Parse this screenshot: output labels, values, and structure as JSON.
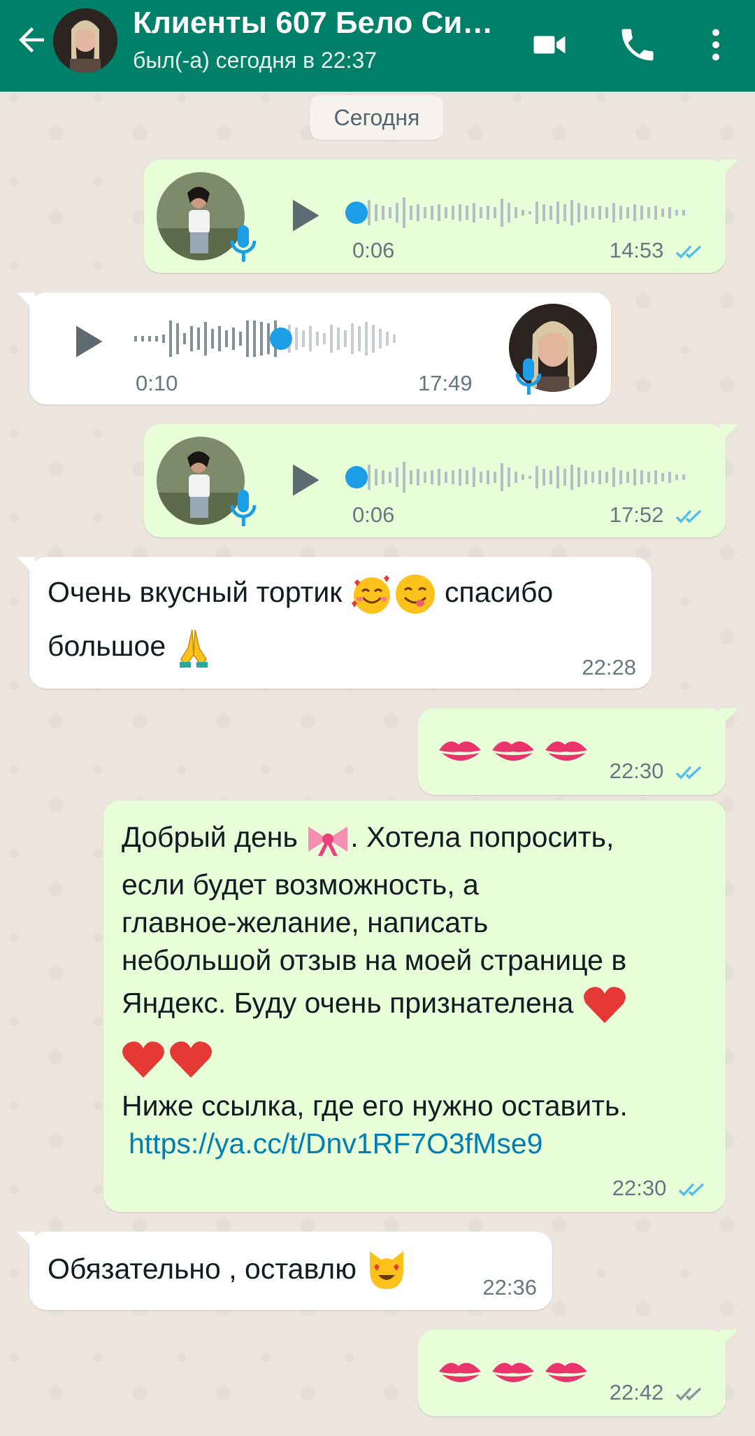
{
  "header": {
    "title": "Клиенты 607 Бело Си…",
    "status": "был(-а) сегодня в 22:37",
    "icons": [
      "back-arrow-icon",
      "video-call-icon",
      "phone-icon",
      "more-vert-icon"
    ]
  },
  "date_chip": "Сегодня",
  "messages": [
    {
      "type": "voice",
      "direction": "out",
      "duration": "0:06",
      "time": "14:53",
      "status": "read"
    },
    {
      "type": "voice",
      "direction": "in",
      "duration": "0:10",
      "time": "17:49"
    },
    {
      "type": "voice",
      "direction": "out",
      "duration": "0:06",
      "time": "17:52",
      "status": "read"
    },
    {
      "type": "text",
      "direction": "in",
      "line1": "Очень вкусный тортик",
      "line1b": "спасибо",
      "line2": "большое",
      "time": "22:28"
    },
    {
      "type": "emoji",
      "direction": "out",
      "time": "22:30",
      "status": "read"
    },
    {
      "type": "text",
      "direction": "out",
      "l1a": "Добрый день",
      "l1b": ".  Хотела попросить,",
      "l2": "если будет возможность,  а",
      "l3": "главное-желание,  написать",
      "l4": "небольшой отзыв на моей странице в",
      "l5": "Яндекс.  Буду очень признателена",
      "l7": "Ниже ссылка, где его нужно оставить.",
      "link": "https://ya.cc/t/Dnv1RF7O3fMse9",
      "time": "22:30",
      "status": "read"
    },
    {
      "type": "text",
      "direction": "in",
      "text": "Обязательно , оставлю",
      "time": "22:36"
    },
    {
      "type": "emoji",
      "direction": "out",
      "time": "22:42",
      "status": "delivered"
    }
  ],
  "colors": {
    "header": "#008069",
    "out_bubble": "#e7fed8",
    "in_bubble": "#ffffff",
    "read_ticks": "#53bdeb",
    "accent_dot": "#1c9ee6"
  }
}
